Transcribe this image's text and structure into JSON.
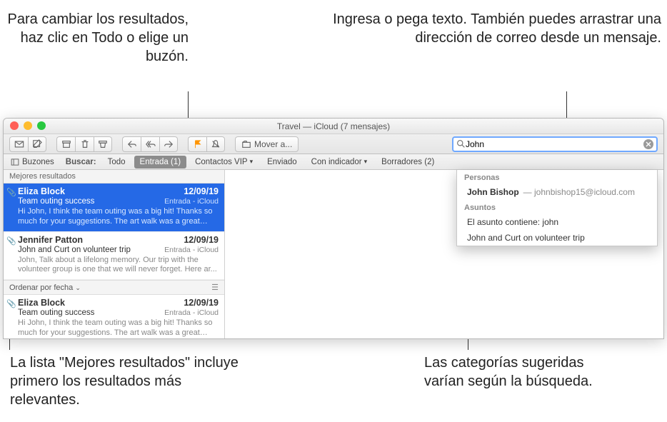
{
  "callouts": {
    "top_left": "Para cambiar los resultados, haz clic en Todo o elige un buzón.",
    "top_right": "Ingresa o pega texto. También puedes arrastrar una dirección de correo desde un mensaje.",
    "bottom_left": "La lista \"Mejores resultados\" incluye primero los resultados más relevantes.",
    "bottom_right": "Las categorías sugeridas varían según la búsqueda."
  },
  "window": {
    "title": "Travel  — iCloud (7 mensajes)"
  },
  "toolbar": {
    "move_label": "Mover a...",
    "search_value": "John"
  },
  "filterbar": {
    "mailboxes": "Buzones",
    "search_label": "Buscar:",
    "all": "Todo",
    "inbox": "Entrada (1)",
    "vip": "Contactos VIP",
    "sent": "Enviado",
    "flagged": "Con indicador",
    "drafts": "Borradores (2)"
  },
  "list": {
    "best_header": "Mejores resultados",
    "sort_label": "Ordenar por fecha",
    "messages": [
      {
        "sender": "Eliza Block",
        "date": "12/09/19",
        "subject": "Team outing success",
        "sub2": "Entrada - iCloud",
        "preview": "Hi John, I think the team outing was a big hit! Thanks so much for your suggestions. The art walk was a great ide..."
      },
      {
        "sender": "Jennifer Patton",
        "date": "12/09/19",
        "subject": "John and Curt on volunteer trip",
        "sub2": "Entrada - iCloud",
        "preview": "John, Talk about a lifelong memory. Our trip with the volunteer group is one that we will never forget. Here ar..."
      },
      {
        "sender": "Eliza Block",
        "date": "12/09/19",
        "subject": "Team outing success",
        "sub2": "Entrada - iCloud",
        "preview": "Hi John, I think the team outing was a big hit! Thanks so much for your suggestions. The art walk was a great ide..."
      }
    ]
  },
  "dropdown": {
    "people_header": "Personas",
    "person_name": "John Bishop",
    "person_email": "johnbishop15@icloud.com",
    "subjects_header": "Asuntos",
    "subject_line1": "El asunto contiene: john",
    "subject_line2": "John and Curt on volunteer trip"
  }
}
